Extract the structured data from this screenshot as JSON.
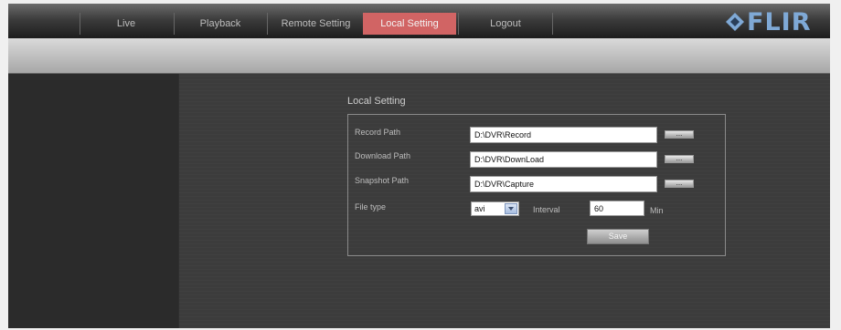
{
  "nav": {
    "tabs": [
      {
        "label": "Live"
      },
      {
        "label": "Playback"
      },
      {
        "label": "Remote Setting"
      },
      {
        "label": "Local Setting",
        "active": true
      },
      {
        "label": "Logout"
      }
    ],
    "active_tab_color": "#d16464",
    "logo": "FLIR",
    "logo_color": "#7fa9d6"
  },
  "local_setting": {
    "title": "Local Setting",
    "record_path": {
      "label": "Record Path",
      "value": "D:\\DVR\\Record",
      "browse": "..."
    },
    "download_path": {
      "label": "Download Path",
      "value": "D:\\DVR\\DownLoad",
      "browse": "..."
    },
    "snapshot_path": {
      "label": "Snapshot Path",
      "value": "D:\\DVR\\Capture",
      "browse": "..."
    },
    "file_type": {
      "label": "File type",
      "value": "avi"
    },
    "interval": {
      "label": "Interval",
      "value": "60",
      "unit": "Min"
    },
    "save_label": "Save"
  }
}
